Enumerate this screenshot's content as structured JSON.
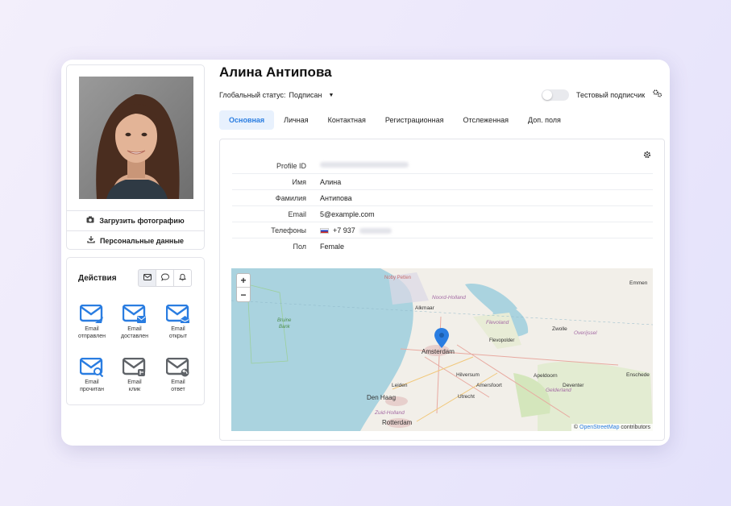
{
  "profile": {
    "name": "Алина Антипова",
    "upload_photo_label": "Загрузить фотографию",
    "personal_data_label": "Персональные данные"
  },
  "status": {
    "label": "Глобальный статус:",
    "value": "Подписан"
  },
  "test_subscriber_label": "Тестовый подписчик",
  "tabs": [
    {
      "label": "Основная",
      "active": true
    },
    {
      "label": "Личная"
    },
    {
      "label": "Контактная"
    },
    {
      "label": "Регистрационная"
    },
    {
      "label": "Отслеженная"
    },
    {
      "label": "Доп. поля"
    }
  ],
  "fields": [
    {
      "key": "Profile ID",
      "value": ""
    },
    {
      "key": "Имя",
      "value": "Алина"
    },
    {
      "key": "Фамилия",
      "value": "Антипова"
    },
    {
      "key": "Email",
      "value": "5@example.com"
    },
    {
      "key": "Телефоны",
      "value": "+7 937"
    },
    {
      "key": "Пол",
      "value": "Female"
    }
  ],
  "actions": {
    "title": "Действия",
    "items": [
      {
        "line1": "Email",
        "line2": "отправлен"
      },
      {
        "line1": "Email",
        "line2": "доставлен"
      },
      {
        "line1": "Email",
        "line2": "открыт"
      },
      {
        "line1": "Email",
        "line2": "прочитан"
      },
      {
        "line1": "Email",
        "line2": "клик"
      },
      {
        "line1": "Email",
        "line2": "ответ"
      }
    ]
  },
  "map": {
    "zoom_in": "+",
    "zoom_out": "−",
    "attribution_prefix": "©",
    "attribution_link": "OpenStreetMap",
    "attribution_suffix": "contributors",
    "labels": {
      "noby": "Noby Petten",
      "nh": "Noord-Holland",
      "alkmaar": "Alkmaar",
      "bruine1": "Bruine",
      "bruine2": "Bank",
      "flevoland": "Flevoland",
      "flevopolder": "Flevopolder",
      "amsterdam": "Amsterdam",
      "zwolle": "Zwolle",
      "overijssel": "Overijssel",
      "emmen": "Emmen",
      "leiden": "Leiden",
      "hilversum": "Hilversum",
      "amersfoort": "Amersfoort",
      "apeldoorn": "Apeldoorn",
      "deventer": "Deventer",
      "enschede": "Enschede",
      "utrecht": "Utrecht",
      "denhaag": "Den Haag",
      "zh": "Zuid-Holland",
      "gelderland": "Gelderland",
      "rotterdam": "Rotterdam"
    }
  }
}
